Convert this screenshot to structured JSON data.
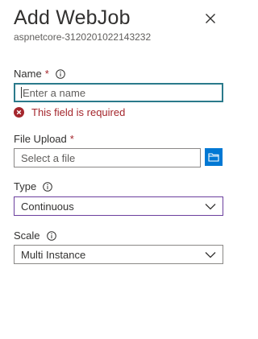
{
  "panel": {
    "title": "Add WebJob",
    "subtitle": "aspnetcore-3120201022143232",
    "close_icon": "close-icon"
  },
  "name_field": {
    "label": "Name",
    "required_mark": "*",
    "placeholder": "Enter a name",
    "value": "",
    "error": "This field is required",
    "error_color": "#a4262c",
    "focus_color": "#2b7a8b"
  },
  "file_upload": {
    "label": "File Upload",
    "required_mark": "*",
    "placeholder": "Select a file",
    "browse_icon": "folder-icon",
    "button_color": "#0078d4"
  },
  "type_field": {
    "label": "Type",
    "selected": "Continuous"
  },
  "scale_field": {
    "label": "Scale",
    "selected": "Multi Instance"
  }
}
